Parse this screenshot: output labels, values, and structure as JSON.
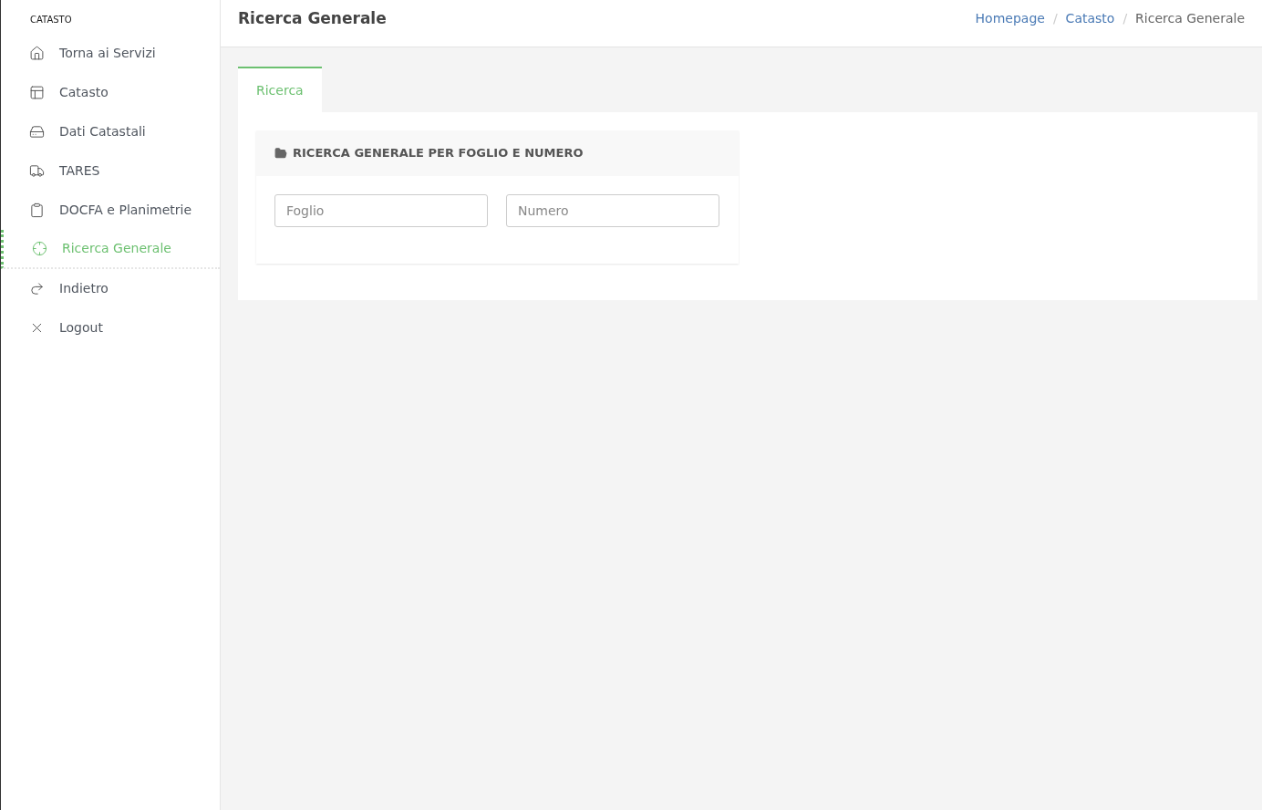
{
  "sidebar": {
    "heading": "CATASTO",
    "items": [
      {
        "label": "Torna ai Servizi",
        "selected": false
      },
      {
        "label": "Catasto",
        "selected": false
      },
      {
        "label": "Dati Catastali",
        "selected": false
      },
      {
        "label": "TARES",
        "selected": false
      },
      {
        "label": "DOCFA e Planimetrie",
        "selected": false
      },
      {
        "label": "Ricerca Generale",
        "selected": true
      },
      {
        "label": "Indietro",
        "selected": false
      },
      {
        "label": "Logout",
        "selected": false
      }
    ]
  },
  "header": {
    "title": "Ricerca Generale",
    "breadcrumbs": [
      {
        "kind": "link",
        "text": "Homepage"
      },
      {
        "kind": "separator",
        "text": "/"
      },
      {
        "kind": "link",
        "text": "Catasto"
      },
      {
        "kind": "separator",
        "text": "/"
      },
      {
        "kind": "current",
        "text": "Ricerca Generale"
      }
    ]
  },
  "tabs": [
    {
      "label": "Ricerca",
      "selected": true
    }
  ],
  "panel": {
    "title": "RICERCA GENERALE PER FOGLIO E NUMERO",
    "fields": [
      {
        "placeholder": "Foglio"
      },
      {
        "placeholder": "Numero"
      }
    ]
  }
}
